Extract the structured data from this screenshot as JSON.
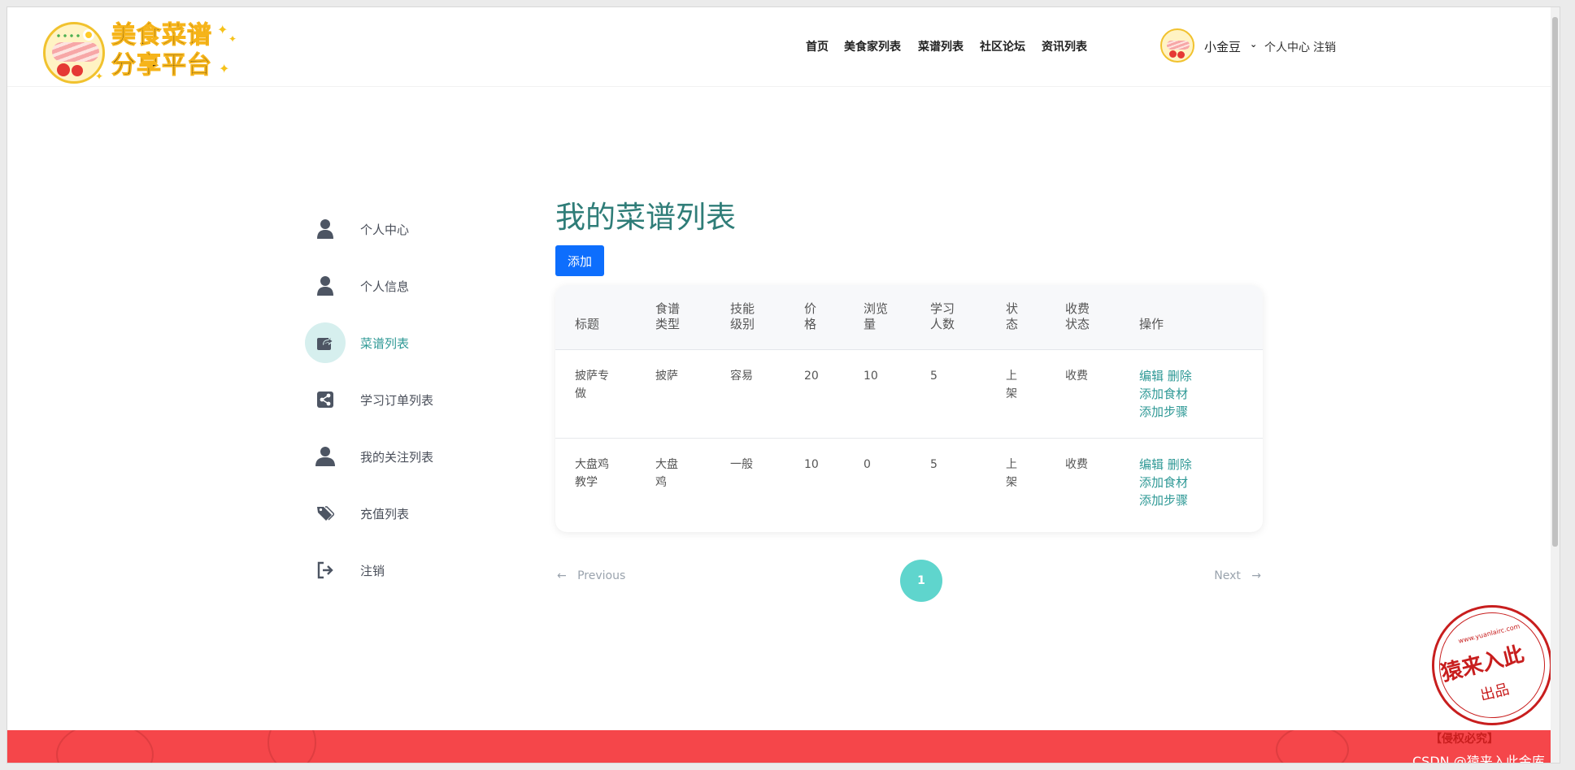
{
  "brand": {
    "line1": "美食菜谱",
    "line2": "分享平台"
  },
  "nav": {
    "items": [
      "首页",
      "美食家列表",
      "菜谱列表",
      "社区论坛",
      "资讯列表"
    ]
  },
  "user": {
    "name": "小金豆",
    "links": [
      "个人中心",
      "注销"
    ]
  },
  "sidebar": {
    "items": [
      {
        "label": "个人中心",
        "icon": "user-icon"
      },
      {
        "label": "个人信息",
        "icon": "user-icon"
      },
      {
        "label": "菜谱列表",
        "icon": "share-square-icon",
        "active": true
      },
      {
        "label": "学习订单列表",
        "icon": "share-nodes-icon"
      },
      {
        "label": "我的关注列表",
        "icon": "user-icon"
      },
      {
        "label": "充值列表",
        "icon": "tags-icon"
      },
      {
        "label": "注销",
        "icon": "sign-out-icon"
      }
    ]
  },
  "main": {
    "title": "我的菜谱列表",
    "add_label": "添加",
    "columns": [
      "标题",
      "食谱\n类型",
      "技能\n级别",
      "价\n格",
      "浏览\n量",
      "学习\n人数",
      "状\n态",
      "收费\n状态",
      "操作"
    ],
    "rows": [
      {
        "title": "披萨专\n做",
        "type": "披萨",
        "level": "容易",
        "price": "20",
        "views": "10",
        "learners": "5",
        "status": "上\n架",
        "charge": "收费"
      },
      {
        "title": "大盘鸡\n教学",
        "type": "大盘\n鸡",
        "level": "一般",
        "price": "10",
        "views": "0",
        "learners": "5",
        "status": "上\n架",
        "charge": "收费"
      }
    ],
    "ops": {
      "edit": "编辑",
      "delete": "删除",
      "add_ingredient": "添加食材",
      "add_step": "添加步骤"
    }
  },
  "pagination": {
    "prev": "Previous",
    "next": "Next",
    "current": "1"
  },
  "watermark": {
    "stamp_main": "猿来入此",
    "stamp_sub": "出品",
    "stamp_url": "www.yuanlairc.com",
    "note": "【侵权必究】",
    "csdn": "CSDN @猿来入此金库"
  },
  "colors": {
    "accent": "#2f9996",
    "primary_button": "#0d6efd",
    "footer": "#f5464a",
    "page_active": "#5fd5cd"
  }
}
